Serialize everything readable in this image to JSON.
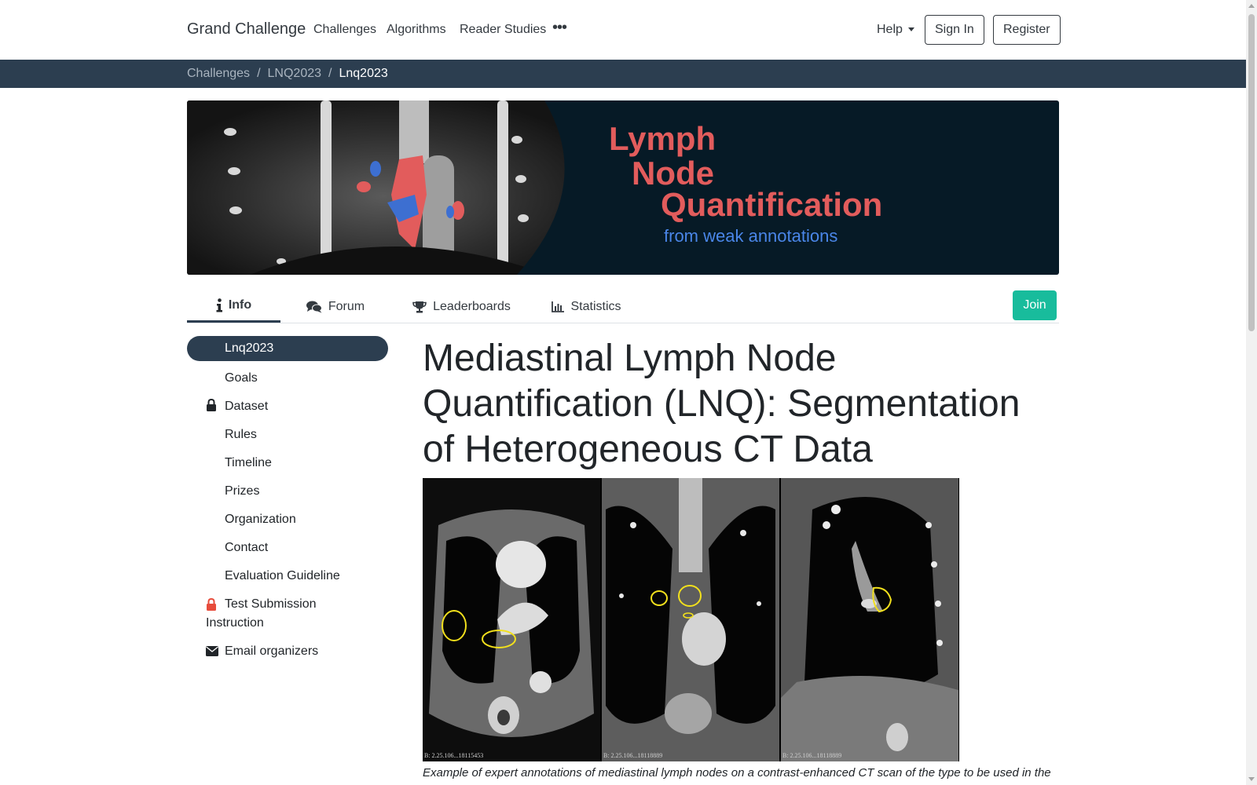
{
  "navbar": {
    "brand": "Grand Challenge",
    "links": [
      "Challenges",
      "Algorithms",
      "Reader Studies"
    ],
    "more": "•••",
    "help": "Help",
    "sign_in": "Sign In",
    "register": "Register"
  },
  "breadcrumb": {
    "items": [
      "Challenges",
      "LNQ2023",
      "Lnq2023"
    ],
    "separator": "/"
  },
  "banner": {
    "line1": "Lymph",
    "line2": "Node",
    "line3": "Quantification",
    "line4": "from weak annotations"
  },
  "tabs": {
    "info": "Info",
    "forum": "Forum",
    "leaderboards": "Leaderboards",
    "statistics": "Statistics",
    "join": "Join"
  },
  "sidebar": {
    "items": [
      {
        "label": "Lnq2023",
        "icon": "",
        "active": true
      },
      {
        "label": "Goals",
        "icon": ""
      },
      {
        "label": "Dataset",
        "icon": "lock-icon"
      },
      {
        "label": "Rules",
        "icon": ""
      },
      {
        "label": "Timeline",
        "icon": ""
      },
      {
        "label": "Prizes",
        "icon": ""
      },
      {
        "label": "Organization",
        "icon": ""
      },
      {
        "label": "Contact",
        "icon": ""
      },
      {
        "label": "Evaluation Guideline",
        "icon": ""
      },
      {
        "label": "Test Submission Instruction",
        "icon": "lock-icon-red"
      },
      {
        "label": "Email organizers",
        "icon": "envelope-icon"
      }
    ]
  },
  "main": {
    "title": "Mediastinal Lymph Node Quantification (LNQ): Segmentation of Heterogeneous CT Data",
    "figure_ids": [
      "B: 2.25.106...18115453",
      "B: 2.25.106...18118889",
      "B: 2.25.106...18118889"
    ],
    "caption": "Example of expert annotations of mediastinal lymph nodes on a contrast-enhanced CT scan of the type to be used in the"
  },
  "colors": {
    "dark": "#2c3e50",
    "accent": "#18bc9c",
    "banner_bg": "#061a26",
    "banner_red": "#e25c5c",
    "banner_blue": "#4a86e8"
  }
}
